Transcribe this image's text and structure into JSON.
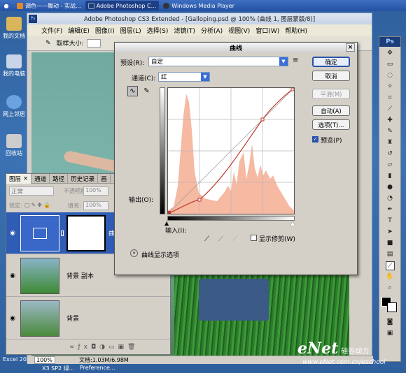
{
  "taskbar": {
    "items": [
      {
        "label": "调色——舞动 - 实战..."
      },
      {
        "label": "Adobe Photoshop C..."
      },
      {
        "label": "Windows Media Player"
      }
    ]
  },
  "desktop": {
    "icons": [
      {
        "label": "我的文档"
      },
      {
        "label": "我的电脑"
      },
      {
        "label": "网上邻居"
      },
      {
        "label": "回收站"
      }
    ],
    "bottom_left": "Excel 200",
    "bottom_tasks": [
      "X3 SP2 绿...",
      "Preference..."
    ]
  },
  "photoshop": {
    "title": "Adobe Photoshop CS3 Extended - [Galloping.psd @ 100% (曲线 1, 图层蒙版/8)]",
    "menu": [
      "文件(F)",
      "编辑(E)",
      "图像(I)",
      "图层(L)",
      "选择(S)",
      "滤镜(T)",
      "分析(A)",
      "视图(V)",
      "窗口(W)",
      "帮助(H)"
    ],
    "options_label": "取样大小:",
    "status_zoom": "100%",
    "status_doc": "文档:1.03M/6.98M"
  },
  "layers_panel": {
    "tabs": [
      "图层",
      "通道",
      "路径",
      "历史记录",
      "画"
    ],
    "blend_mode": "正常",
    "opacity_label": "不透明度:",
    "opacity_value": "100%",
    "lock_label": "锁定:",
    "fill_label": "填充:",
    "fill_value": "100%",
    "layers": [
      {
        "name": "曲"
      },
      {
        "name": "背景 副本"
      },
      {
        "name": "背景"
      }
    ]
  },
  "curves_dialog": {
    "title": "曲线",
    "preset_label": "预设(R):",
    "preset_value": "自定",
    "channel_label": "通道(C):",
    "channel_value": "红",
    "output_label": "输出(O):",
    "input_label": "输入(I):",
    "show_clipping_label": "显示修剪(W)",
    "curve_options_label": "曲线显示选项",
    "buttons": {
      "ok": "确定",
      "cancel": "取消",
      "smooth": "平滑(M)",
      "auto": "自动(A)",
      "options": "选项(T)..."
    },
    "preview_label": "预览(P)",
    "preview_checked": true
  },
  "watermark": {
    "logo": "eNet",
    "suffix": "硅谷动力",
    "url": "www.eNet.com.cn/eschool"
  },
  "colors": {
    "histogram": "#f6b9a1",
    "curve": "#c0372c",
    "selected_layer": "#2f5cb4"
  }
}
